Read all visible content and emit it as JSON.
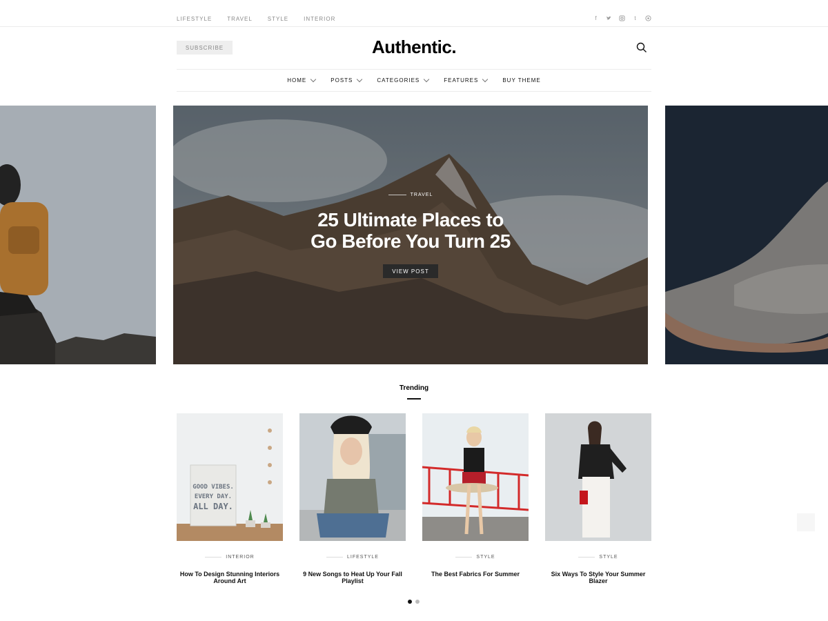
{
  "topbar": {
    "nav": [
      "LIFESTYLE",
      "TRAVEL",
      "STYLE",
      "INTERIOR"
    ],
    "social": [
      "facebook-icon",
      "twitter-icon",
      "instagram-icon",
      "tumblr-icon",
      "pinterest-icon"
    ]
  },
  "header": {
    "subscribe_label": "SUBSCRIBE",
    "logo": "Authentic."
  },
  "mainnav": [
    {
      "label": "HOME",
      "dropdown": true
    },
    {
      "label": "POSTS",
      "dropdown": true
    },
    {
      "label": "CATEGORIES",
      "dropdown": true
    },
    {
      "label": "FEATURES",
      "dropdown": true
    },
    {
      "label": "BUY THEME",
      "dropdown": false
    }
  ],
  "hero": {
    "category": "TRAVEL",
    "title_line1": "25 Ultimate Places to",
    "title_line2": "Go Before You Turn 25",
    "button": "VIEW POST"
  },
  "trending": {
    "heading": "Trending",
    "cards": [
      {
        "category": "INTERIOR",
        "title": "How To Design Stunning Interiors Around Art",
        "image_text": [
          "GOOD VIBES.",
          "EVERY DAY.",
          "ALL DAY."
        ]
      },
      {
        "category": "LIFESTYLE",
        "title": "9 New Songs to Heat Up Your Fall Playlist"
      },
      {
        "category": "STYLE",
        "title": "The Best Fabrics For Summer"
      },
      {
        "category": "STYLE",
        "title": "Six Ways To Style Your Summer Blazer"
      }
    ],
    "pagination": {
      "pages": 2,
      "active": 1
    }
  },
  "colors": {
    "accent": "#000000",
    "muted_text": "#8a8a8a",
    "button_dark": "#2a2a2a",
    "slide_right_bg": "#1b2532"
  }
}
